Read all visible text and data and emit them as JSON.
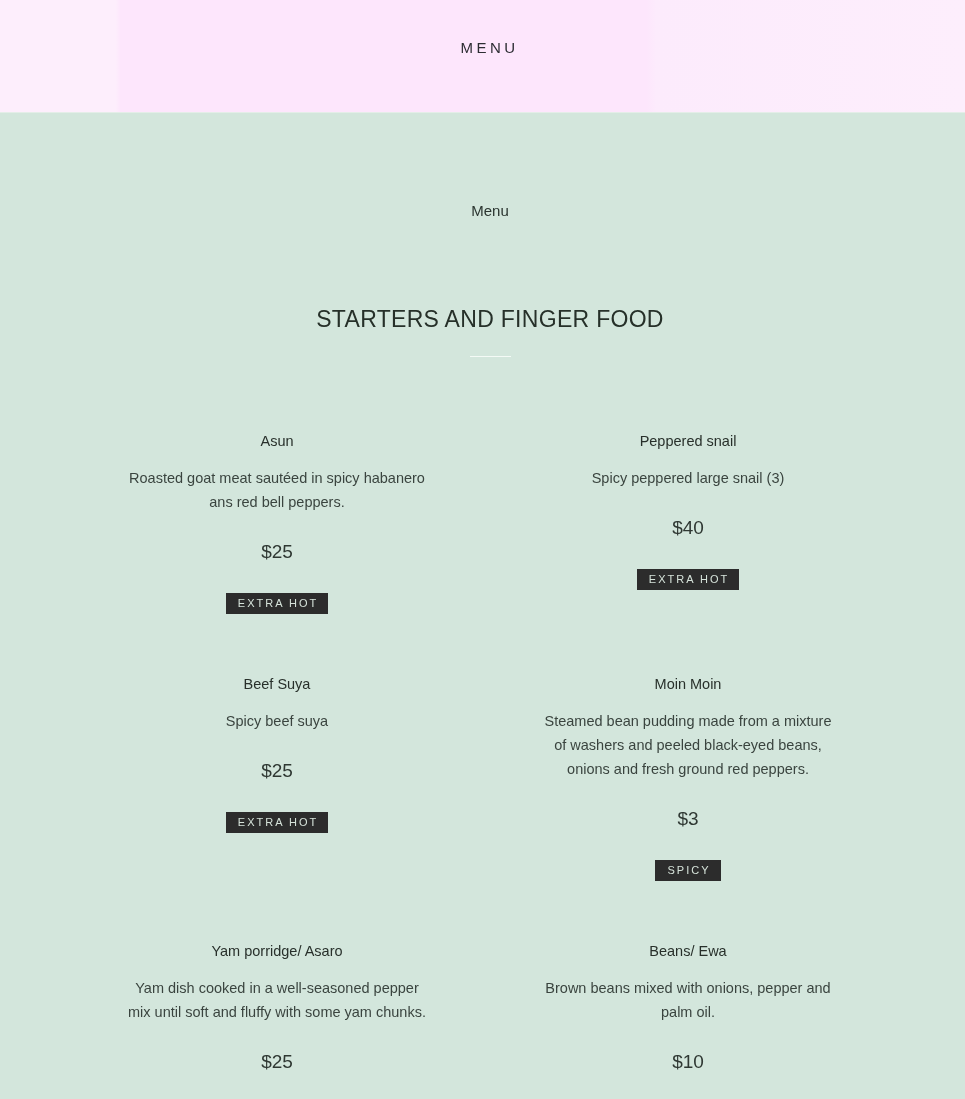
{
  "header": {
    "title": "MENU"
  },
  "breadcrumb": "Menu",
  "section": {
    "title": "STARTERS AND FINGER FOOD",
    "items": [
      {
        "name": "Asun",
        "description": "Roasted goat meat sautéed in spicy habanero ans red bell peppers.",
        "price": "$25",
        "tag": "EXTRA HOT"
      },
      {
        "name": "Peppered snail",
        "description": "Spicy peppered large snail (3)",
        "price": "$40",
        "tag": "EXTRA HOT"
      },
      {
        "name": "Beef Suya",
        "description": "Spicy beef suya",
        "price": "$25",
        "tag": "EXTRA HOT"
      },
      {
        "name": "Moin Moin",
        "description": "Steamed bean pudding made from a mixture of washers and peeled black-eyed beans, onions and fresh ground red peppers.",
        "price": "$3",
        "tag": "SPICY"
      },
      {
        "name": "Yam porridge/ Asaro",
        "description": "Yam dish cooked in a well-seasoned pepper mix until soft and fluffy with some yam chunks.",
        "price": "$25"
      },
      {
        "name": "Beans/ Ewa",
        "description": "Brown beans mixed with onions, pepper and palm oil.",
        "price": "$10"
      }
    ]
  }
}
